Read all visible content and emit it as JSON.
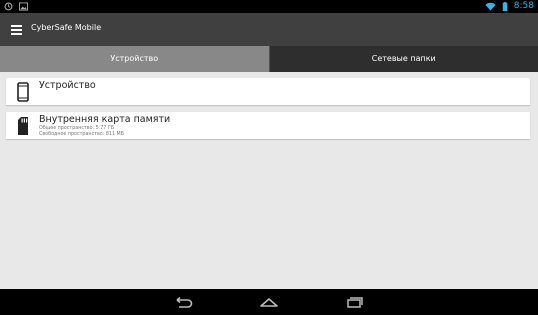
{
  "status_bar": {
    "time": "8:58",
    "icons": [
      "sync-icon",
      "image-icon",
      "wifi-icon",
      "battery-icon"
    ]
  },
  "app": {
    "title": "CyberSafe Mobile"
  },
  "tabs": [
    {
      "label": "Устройство",
      "active": true
    },
    {
      "label": "Сетевые папки",
      "active": false
    }
  ],
  "items": [
    {
      "title": "Устройство",
      "icon": "phone-icon"
    },
    {
      "title": "Внутренняя карта памяти",
      "icon": "sd-card-icon",
      "total_space": "Общее пространство: 5.77 ГБ",
      "free_space": "Свободное пространство: 811 МБ"
    }
  ],
  "colors": {
    "accent": "#33b5e5",
    "action_bar": "#404040",
    "tab_bar": "#2e2e2e",
    "tab_active": "#888888",
    "content_bg": "#e8e8e8"
  },
  "nav": [
    "back-icon",
    "home-icon",
    "recent-apps-icon"
  ]
}
